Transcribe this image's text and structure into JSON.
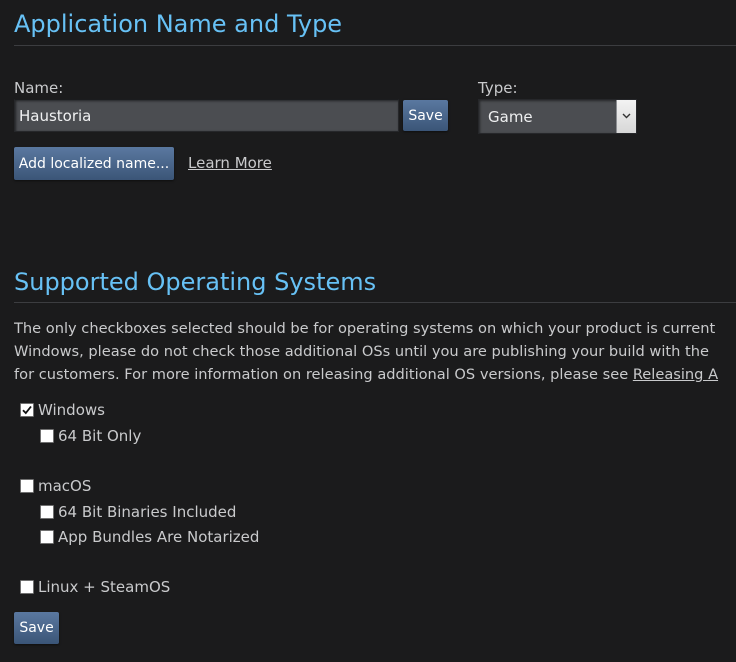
{
  "app_section": {
    "title": "Application Name and Type",
    "name_label": "Name:",
    "name_value": "Haustoria",
    "save_label": "Save",
    "type_label": "Type:",
    "type_value": "Game",
    "add_localized_label": "Add localized name...",
    "learn_more_label": "Learn More"
  },
  "os_section": {
    "title": "Supported Operating Systems",
    "description_lines": [
      "The only checkboxes selected should be for operating systems on which your product is current",
      "Windows, please do not check those additional OSs until you are publishing your build with the",
      "for customers. For more information on releasing additional OS versions, please see "
    ],
    "description_link": "Releasing A",
    "options": {
      "windows": {
        "label": "Windows",
        "checked": true
      },
      "windows_64": {
        "label": "64 Bit Only",
        "checked": false
      },
      "macos": {
        "label": "macOS",
        "checked": false
      },
      "macos_64": {
        "label": "64 Bit Binaries Included",
        "checked": false
      },
      "macos_notarized": {
        "label": "App Bundles Are Notarized",
        "checked": false
      },
      "linux": {
        "label": "Linux + SteamOS",
        "checked": false
      }
    },
    "save_label": "Save"
  },
  "colors": {
    "background": "#1b1b1c",
    "heading": "#67c1f5",
    "text": "#c9cacc",
    "button_top": "#5a78a0",
    "button_bottom": "#3b5577"
  }
}
